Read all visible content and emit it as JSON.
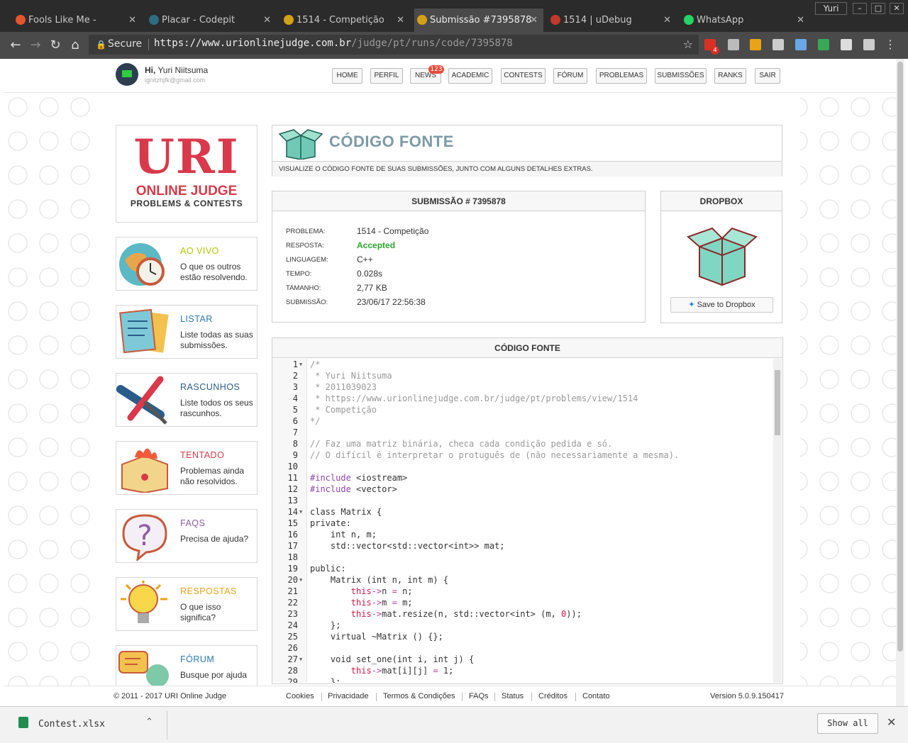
{
  "browser": {
    "tabs": [
      {
        "title": "Fools Like Me -",
        "icon": "music-icon",
        "color": "#e4572e",
        "active": false
      },
      {
        "title": "Placar - Codepit",
        "icon": "codepit-icon",
        "color": "#2c6e7f",
        "active": false
      },
      {
        "title": "1514 - Competição",
        "icon": "trophy-icon",
        "color": "#d4a017",
        "active": false
      },
      {
        "title": "Submissão #7395878",
        "icon": "trophy-icon",
        "color": "#d4a017",
        "active": true
      },
      {
        "title": "1514 | uDebug",
        "icon": "udebug-icon",
        "color": "#c0392b",
        "active": false
      },
      {
        "title": "WhatsApp",
        "icon": "whatsapp-icon",
        "color": "#25d366",
        "active": false
      }
    ],
    "profile_name": "Yuri",
    "secure_label": "Secure",
    "url_host": "https://www.urionlinejudge.com.br",
    "url_path": "/judge/pt/runs/code/7395878",
    "gmail_badge": "4"
  },
  "header": {
    "greeting": "Hi,",
    "user_name": "Yuri Niitsuma",
    "email": "ignitzhjfk@gmail.com",
    "menu": [
      "HOME",
      "PERFIL",
      "NEWS",
      "ACADEMIC",
      "CONTESTS",
      "FÓRUM",
      "PROBLEMAS",
      "SUBMISSÕES",
      "RANKS",
      "SAIR"
    ],
    "news_badge": "123"
  },
  "logo": {
    "uri": "URI",
    "online_judge": "ONLINE JUDGE",
    "tagline": "PROBLEMS & CONTESTS"
  },
  "sidebar": [
    {
      "title": "AO VIVO",
      "desc": "O que os outros estão resolvendo.",
      "color": "#b5c600",
      "icon": "globe-clock-icon"
    },
    {
      "title": "LISTAR",
      "desc": "Liste todas as suas submissões.",
      "color": "#2a7ab0",
      "icon": "list-cards-icon"
    },
    {
      "title": "RASCUNHOS",
      "desc": "Liste todos os seus rascunhos.",
      "color": "#2a5c8a",
      "icon": "pens-icon"
    },
    {
      "title": "TENTADO",
      "desc": "Problemas ainda não resolvidos.",
      "color": "#d9394a",
      "icon": "burning-box-icon"
    },
    {
      "title": "FAQS",
      "desc": "Precisa de ajuda?",
      "color": "#8e5ea2",
      "icon": "question-bubble-icon"
    },
    {
      "title": "RESPOSTAS",
      "desc": "O que isso significa?",
      "color": "#e8a317",
      "icon": "lightbulb-icon"
    },
    {
      "title": "FÓRUM",
      "desc": "Busque por ajuda",
      "color": "#2a7ab0",
      "icon": "forum-chat-icon"
    }
  ],
  "source_header": {
    "title": "CÓDIGO FONTE",
    "subtitle": "VISUALIZE O CÓDIGO FONTE DE SUAS SUBMISSÕES, JUNTO COM ALGUNS DETALHES EXTRAS."
  },
  "submission": {
    "title": "SUBMISSÃO # 7395878",
    "rows": [
      {
        "label": "PROBLEMA:",
        "value": "1514 - Competição"
      },
      {
        "label": "RESPOSTA:",
        "value": "Accepted"
      },
      {
        "label": "LINGUAGEM:",
        "value": "C++"
      },
      {
        "label": "TEMPO:",
        "value": "0.028s"
      },
      {
        "label": "TAMANHO:",
        "value": "2,77 KB"
      },
      {
        "label": "SUBMISSÃO:",
        "value": "23/06/17 22:56:38"
      }
    ],
    "accepted_color": "#2ca52c"
  },
  "dropbox": {
    "title": "DROPBOX",
    "button": "Save to Dropbox"
  },
  "code": {
    "title": "CÓDIGO FONTE",
    "fold_lines": [
      1,
      14,
      20,
      27
    ],
    "lines": [
      "/*",
      " * Yuri Niitsuma",
      " * 2011039023",
      " * https://www.urionlinejudge.com.br/judge/pt/problems/view/1514",
      " * Competição",
      "*/",
      "",
      "// Faz uma matriz binária, checa cada condição pedida e só.",
      "// O difícil é interpretar o protuguês de (não necessariamente a mesma).",
      "",
      "#include <iostream>",
      "#include <vector>",
      "",
      "class Matrix {",
      "private:",
      "    int n, m;",
      "    std::vector<std::vector<int>> mat;",
      "",
      "public:",
      "    Matrix (int n, int m) {",
      "        this->n = n;",
      "        this->m = m;",
      "        this->mat.resize(n, std::vector<int> (m, 0));",
      "    };",
      "    virtual ~Matrix () {};",
      "",
      "    void set_one(int i, int j) {",
      "        this->mat[i][j] = 1;",
      "    };"
    ]
  },
  "footer": {
    "copyright": "© 2011 - 2017 URI Online Judge",
    "links": [
      "Cookies",
      "Privacidade",
      "Termos & Condições",
      "FAQs",
      "Status",
      "Créditos",
      "Contato"
    ],
    "version": "Version 5.0.9.150417"
  },
  "downloads": {
    "file": "Contest.xlsx",
    "show_all": "Show all"
  }
}
